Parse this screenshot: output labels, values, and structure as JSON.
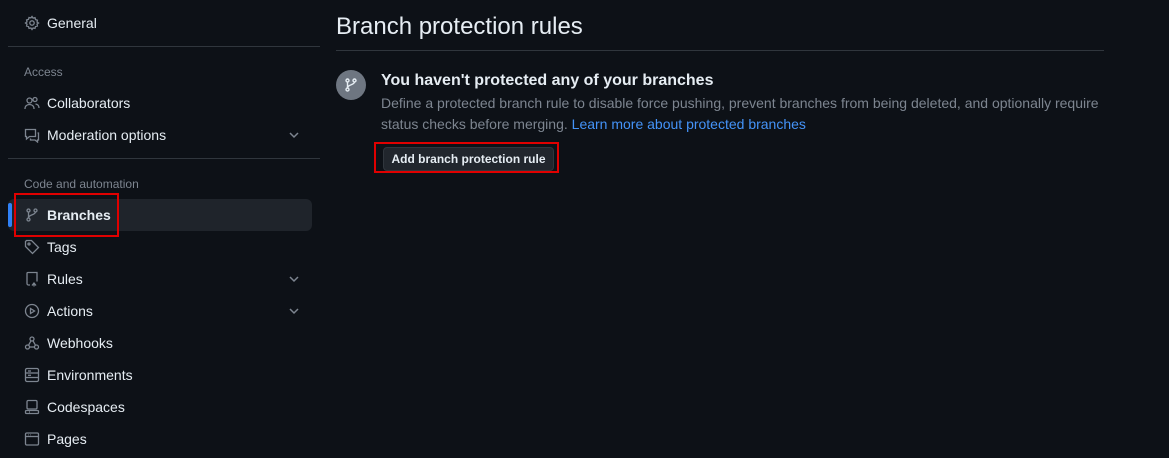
{
  "sidebar": {
    "general": "General",
    "access_heading": "Access",
    "collaborators": "Collaborators",
    "moderation": "Moderation options",
    "code_heading": "Code and automation",
    "branches": "Branches",
    "tags": "Tags",
    "rules": "Rules",
    "actions": "Actions",
    "webhooks": "Webhooks",
    "environments": "Environments",
    "codespaces": "Codespaces",
    "pages": "Pages",
    "active_item": "Branches",
    "icons": {
      "general": "gear-icon",
      "collaborators": "people-icon",
      "moderation": "report-icon",
      "branches": "git-branch-icon",
      "tags": "tag-icon",
      "rules": "repo-push-icon",
      "actions": "play-icon",
      "webhooks": "webhook-icon",
      "environments": "server-icon",
      "codespaces": "codespaces-icon",
      "pages": "browser-icon"
    }
  },
  "main": {
    "title": "Branch protection rules",
    "blank_title": "You haven't protected any of your branches",
    "blank_desc": "Define a protected branch rule to disable force pushing, prevent branches from being deleted, and optionally require status checks before merging.",
    "learn_more": "Learn more about protected branches",
    "add_button": "Add branch protection rule"
  },
  "colors": {
    "background": "#0d1117",
    "text": "#e6edf3",
    "muted": "#7d8590",
    "link": "#4493f8",
    "accent": "#2f81f7",
    "highlight": "#e00000"
  }
}
